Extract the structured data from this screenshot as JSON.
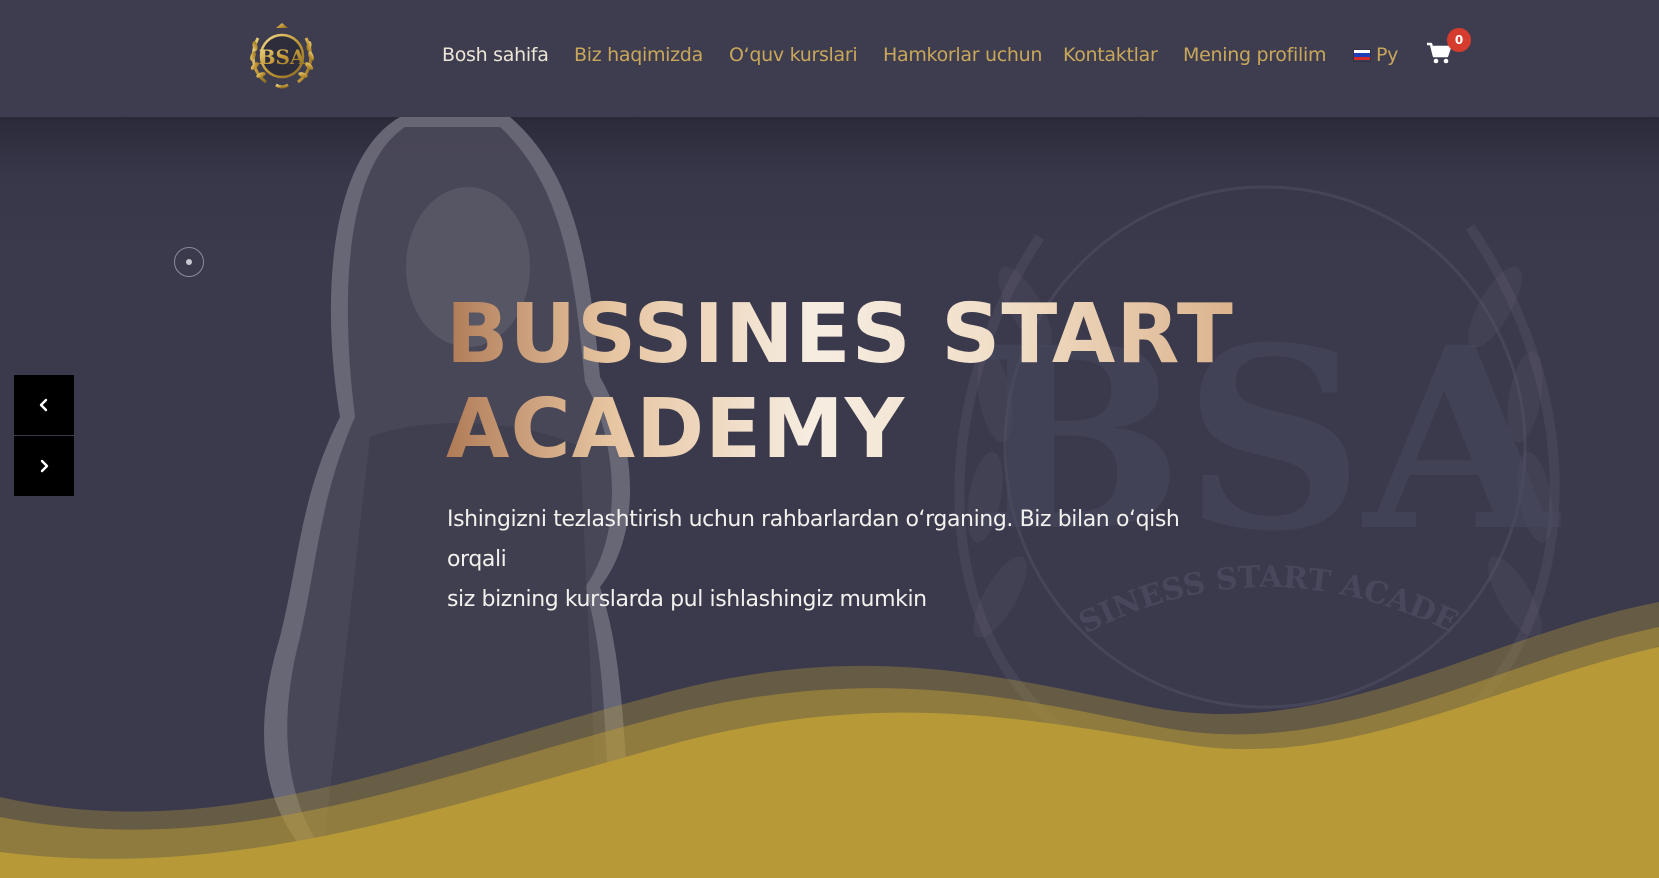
{
  "header": {
    "logo_text": "BSA",
    "nav": [
      {
        "label": "Bosh sahifa",
        "active": true
      },
      {
        "label": "Biz haqimizda"
      },
      {
        "label": "O‘quv kurslari"
      },
      {
        "label": "Hamkorlar uchun"
      },
      {
        "label": "Kontaktlar"
      },
      {
        "label": "Mening profilim"
      }
    ],
    "language": {
      "label": "Ру",
      "flag": "ru-flag-icon"
    },
    "cart": {
      "icon": "cart-icon",
      "count": "0"
    }
  },
  "hero": {
    "title_line1": "BUSSINES START",
    "title_line2": "ACADEMY",
    "subtitle_line1": "Ishingizni tezlashtirish uchun rahbarlardan o‘rganing. Biz bilan o‘qish orqali",
    "subtitle_line2": "siz bizning kurslarda pul ishlashingiz mumkin",
    "watermark_text": "BUSINESS START ACADEMY",
    "watermark_letters": "BSA",
    "slider": {
      "prev_icon": "chevron-left-icon",
      "next_icon": "chevron-right-icon",
      "dot_icon": "slide-dot-icon"
    }
  },
  "colors": {
    "header_bg": "#3e3d50",
    "hero_bg": "#3b3a4c",
    "gold_accent": "#c9a75a",
    "wave_gold": "#b79a37",
    "nav_active": "#ece6d6",
    "badge": "#d63c2e"
  }
}
